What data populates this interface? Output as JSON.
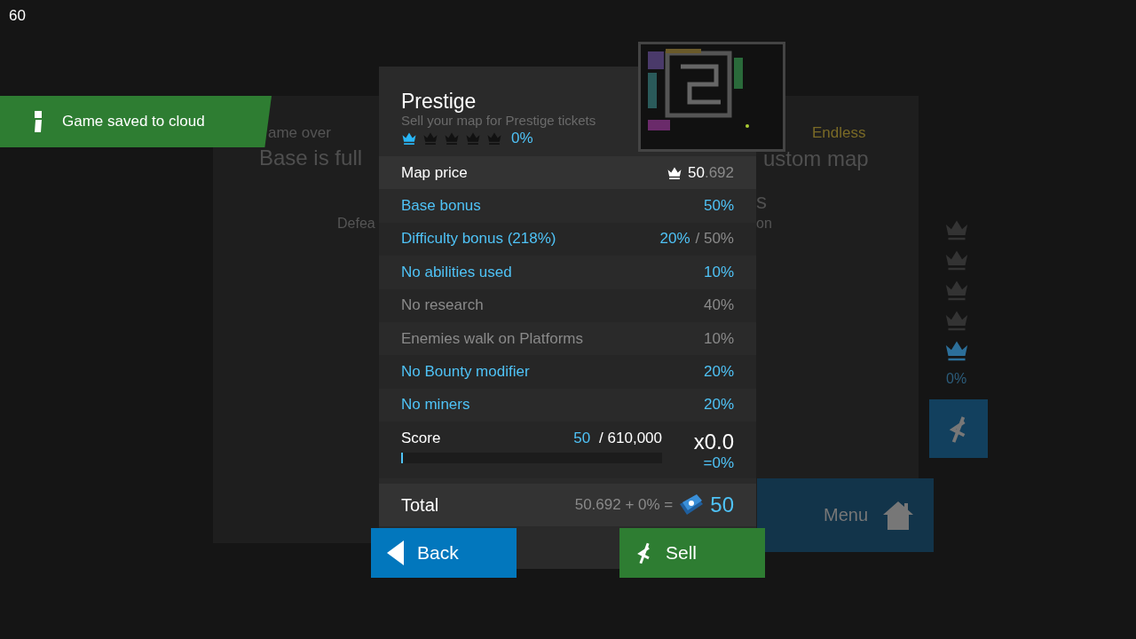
{
  "fps": "60",
  "toast": {
    "text": "Game saved to cloud"
  },
  "background_panel": {
    "left_subtitle": "ame over",
    "left_title": "Base is full",
    "left_text": "Defea",
    "right_subtitle": "Endless",
    "right_title": "ustom map",
    "right_fragment": "s",
    "right_text": "on"
  },
  "side_rating": {
    "crowns": [
      {
        "filled": false
      },
      {
        "filled": false
      },
      {
        "filled": false
      },
      {
        "filled": false
      },
      {
        "filled": true
      }
    ],
    "percent": "0%"
  },
  "menu_button": {
    "label": "Menu"
  },
  "dialog": {
    "title": "Prestige",
    "subtitle": "Sell your map for Prestige tickets",
    "stars": 1,
    "percent": "0%",
    "map_price": {
      "label": "Map price",
      "value": "50",
      "decimals": ".692"
    },
    "bonuses": [
      {
        "label": "Base bonus",
        "value": "50%",
        "active": true
      },
      {
        "label": "Difficulty bonus (218%)",
        "value": "20%",
        "max": "/ 50%",
        "active": true
      },
      {
        "label": "No abilities used",
        "value": "10%",
        "active": true
      },
      {
        "label": "No research",
        "value": "40%",
        "active": false
      },
      {
        "label": "Enemies walk on Platforms",
        "value": "10%",
        "active": false
      },
      {
        "label": "No Bounty modifier",
        "value": "20%",
        "active": true
      },
      {
        "label": "No miners",
        "value": "20%",
        "active": true
      }
    ],
    "score": {
      "label": "Score",
      "value": "50",
      "target": "/ 610,000",
      "level": 0.005,
      "multiplier": "x0.0",
      "percent": "=0%"
    },
    "total": {
      "label": "Total",
      "formula": "50.692 + 0% =",
      "value": "50"
    },
    "buttons": [
      {
        "kind": "back",
        "label": "Back"
      },
      {
        "kind": "sell",
        "label": "Sell"
      }
    ]
  }
}
